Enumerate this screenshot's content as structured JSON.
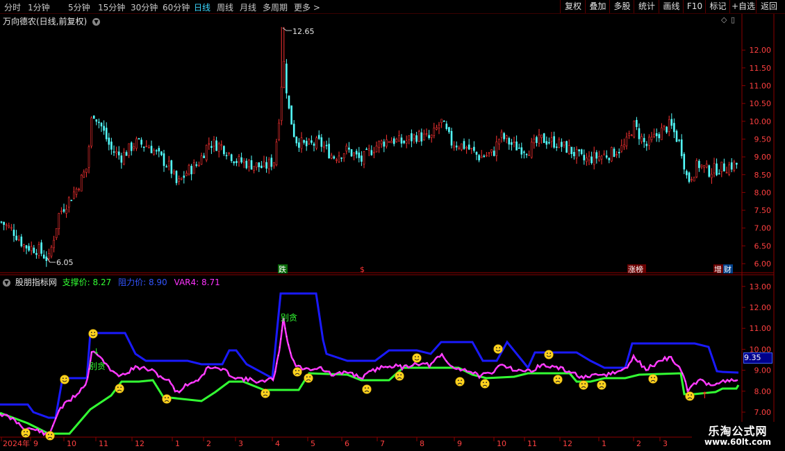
{
  "toolbar": {
    "timeframes": [
      "分时",
      "1分钟",
      "5分钟",
      "15分钟",
      "30分钟",
      "60分钟",
      "日线",
      "周线",
      "月线",
      "多周期",
      "更多"
    ],
    "active_timeframe": "日线",
    "more_arrow": ">",
    "right_buttons": [
      "复权",
      "叠加",
      "多股",
      "统计",
      "画线",
      "F10",
      "标记",
      "+自选",
      "返回"
    ]
  },
  "main_chart": {
    "title": "万向德农(日线,前复权)",
    "high_label": "12.65",
    "low_label": "6.05",
    "y_ticks": [
      "12.00",
      "11.50",
      "11.00",
      "10.50",
      "10.00",
      "9.50",
      "9.00",
      "8.50",
      "8.00",
      "7.50",
      "7.00",
      "6.50",
      "6.00"
    ],
    "markers": {
      "die": "跌",
      "dollar": "$",
      "zhangbang": "涨榜",
      "zengcai": "增",
      "cai": "财"
    }
  },
  "indicator": {
    "name": "股朋指标网",
    "support_label": "支撑价:",
    "support_value": "8.27",
    "resist_label": "阻力价:",
    "resist_value": "8.90",
    "var4_label": "VAR4:",
    "var4_value": "8.71",
    "price_tag": "9.35",
    "y_ticks": [
      "13.00",
      "12.00",
      "11.00",
      "10.00",
      "9.00",
      "8.00",
      "7.00"
    ],
    "annotations": [
      "别贪",
      "别贪"
    ]
  },
  "x_axis": {
    "labels": [
      "2024年",
      "9",
      "10",
      "11",
      "12",
      "1",
      "2",
      "3",
      "4",
      "5",
      "6",
      "7",
      "8",
      "9",
      "10",
      "11",
      "12",
      "1",
      "2",
      "3"
    ]
  },
  "watermark": {
    "line1": "乐淘公式网",
    "line2": "www.60lt.com"
  },
  "colors": {
    "up": "#ff3333",
    "down": "#54ffff",
    "support": "#33ff33",
    "resist": "#1a1aff",
    "var4": "#ff33ff",
    "axis": "#8b0000",
    "tick_text": "#ff4040"
  }
}
